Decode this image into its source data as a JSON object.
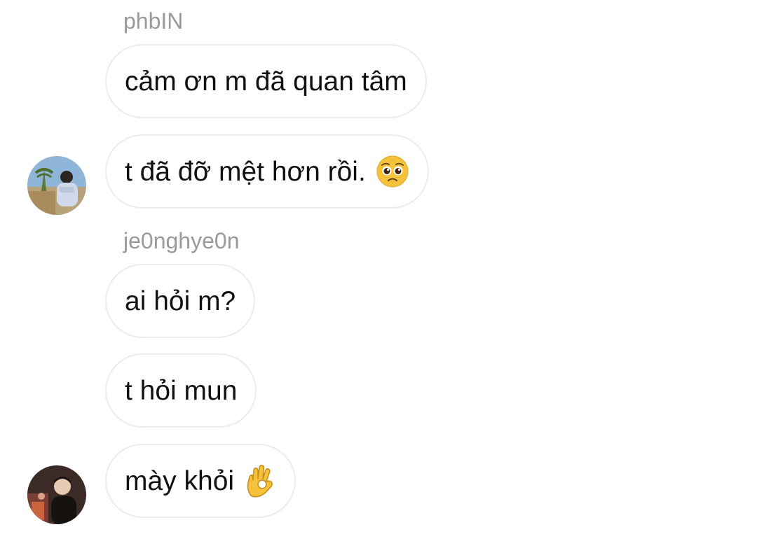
{
  "groups": [
    {
      "sender": "phbIN",
      "messages": [
        {
          "text": "cảm ơn m đã quan tâm"
        },
        {
          "text": "t đã đỡ mệt hơn rồi.",
          "emoji": "pleading-face-icon"
        }
      ]
    },
    {
      "sender": "je0nghye0n",
      "messages": [
        {
          "text": "ai hỏi m?"
        },
        {
          "text": "t hỏi mun"
        },
        {
          "text": "mày khỏi",
          "emoji": "ok-hand-icon"
        }
      ]
    }
  ],
  "colors": {
    "sender_name": "#9a9a9a",
    "bubble_border": "#ececec",
    "message_text": "#111111",
    "emoji_yellow": "#f5c33b"
  }
}
